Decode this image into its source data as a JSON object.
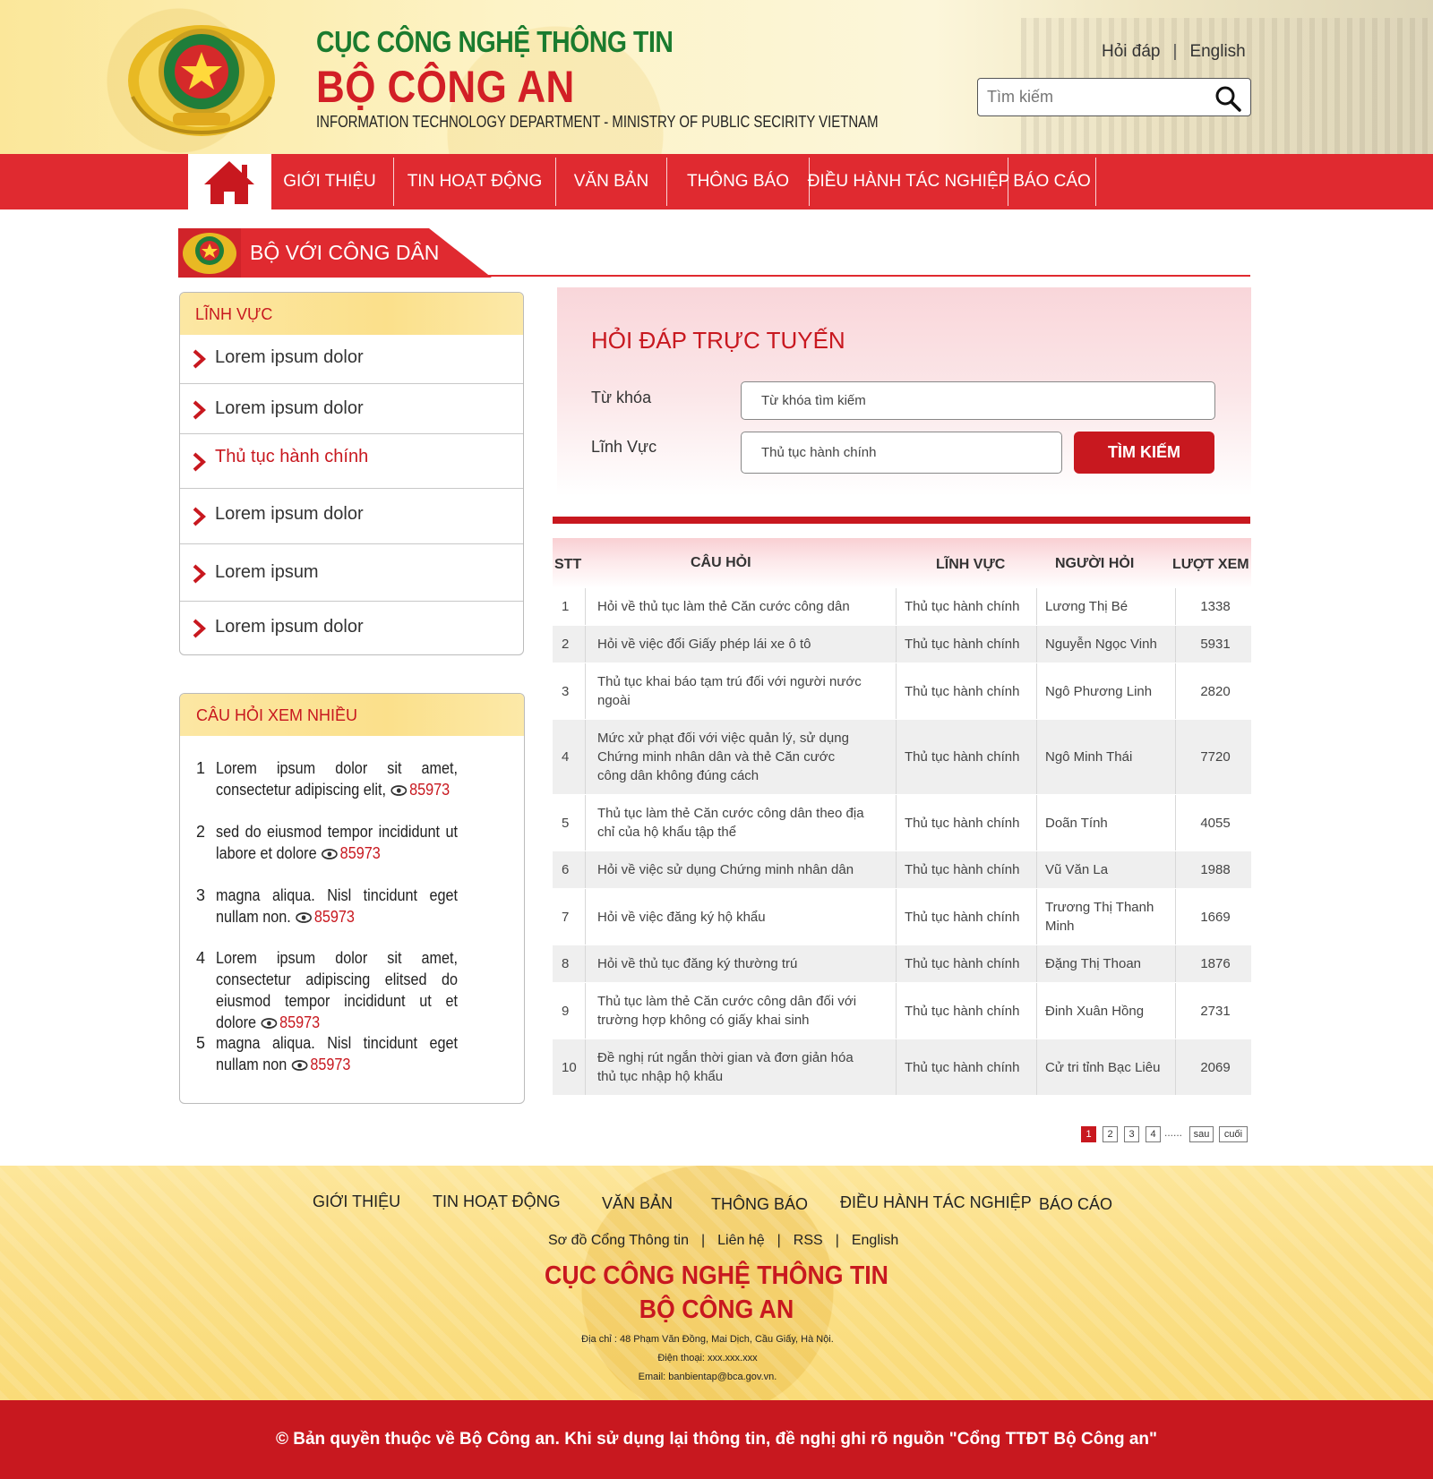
{
  "header": {
    "title_line1": "CỤC CÔNG NGHỆ THÔNG TIN",
    "title_line2": "BỘ CÔNG AN",
    "subtitle": "INFORMATION TECHNOLOGY DEPARTMENT - MINISTRY OF PUBLIC SECIRITY VIETNAM",
    "links": [
      "Hỏi đáp",
      "English"
    ],
    "search_placeholder": "Tìm kiếm"
  },
  "nav": {
    "items": [
      "GIỚI THIỆU",
      "TIN HOẠT ĐỘNG",
      "VĂN BẢN",
      "THÔNG BÁO",
      "ĐIỀU HÀNH TÁC NGHIỆP",
      "BÁO CÁO"
    ]
  },
  "section_title": "BỘ VỚI CÔNG DÂN",
  "sidebar": {
    "categories_title": "LĨNH VỰC",
    "categories": [
      "Lorem ipsum dolor",
      "Lorem ipsum dolor",
      "Thủ tục hành chính",
      "Lorem ipsum dolor",
      "Lorem ipsum",
      "Lorem ipsum dolor"
    ],
    "popular_title": "CÂU HỎI XEM NHIỀU",
    "popular": [
      {
        "num": "1",
        "text": "Lorem ipsum dolor sit amet, consectetur adipiscing elit,",
        "views": "85973"
      },
      {
        "num": "2",
        "text": "sed do eiusmod tempor incididunt ut labore et dolore",
        "views": "85973"
      },
      {
        "num": "3",
        "text": "magna aliqua. Nisl tincidunt eget nullam non.",
        "views": "85973"
      },
      {
        "num": "4",
        "text": "Lorem ipsum dolor sit amet, consectetur adipiscing elitsed do eiusmod tempor incididunt ut et dolore",
        "views": "85973"
      },
      {
        "num": "5",
        "text": "magna aliqua. Nisl tincidunt eget nullam non",
        "views": "85973"
      }
    ]
  },
  "search_panel": {
    "title": "HỎI ĐÁP TRỰC TUYẾN",
    "keyword_label": "Từ khóa",
    "keyword_placeholder": "Từ khóa tìm kiếm",
    "field_label": "Lĩnh Vực",
    "field_value": "Thủ tục hành chính",
    "button": "TÌM KIẾM"
  },
  "table": {
    "headers": [
      "STT",
      "CÂU HỎI",
      "LĨNH VỰC",
      "NGƯỜI HỎI",
      "LƯỢT XEM"
    ],
    "rows": [
      {
        "stt": "1",
        "question": "Hỏi về thủ tục làm thẻ Căn cước công dân",
        "field": "Thủ tục hành chính",
        "asker": "Lương Thị Bé",
        "views": "1338"
      },
      {
        "stt": "2",
        "question": "Hỏi về việc đổi Giấy phép lái xe ô tô",
        "field": "Thủ tục hành chính",
        "asker": "Nguyễn Ngọc Vinh",
        "views": "5931"
      },
      {
        "stt": "3",
        "question": "Thủ tục khai báo tạm trú đối với người nước ngoài",
        "field": "Thủ tục hành chính",
        "asker": "Ngô Phương Linh",
        "views": "2820"
      },
      {
        "stt": "4",
        "question": "Mức xử phạt đối với việc quản lý, sử dụng Chứng minh nhân dân và thẻ Căn cước công dân không đúng cách",
        "field": "Thủ tục hành chính",
        "asker": "Ngô Minh Thái",
        "views": "7720"
      },
      {
        "stt": "5",
        "question": "Thủ tục làm thẻ Căn cước công dân theo địa chỉ của hộ khẩu tập thể",
        "field": "Thủ tục hành chính",
        "asker": "Doãn Tính",
        "views": "4055"
      },
      {
        "stt": "6",
        "question": "Hỏi về việc sử dụng Chứng minh nhân dân",
        "field": "Thủ tục hành chính",
        "asker": "Vũ Văn La",
        "views": "1988"
      },
      {
        "stt": "7",
        "question": "Hỏi về việc đăng ký hộ khẩu",
        "field": "Thủ tục hành chính",
        "asker": "Trương Thị Thanh Minh",
        "views": "1669"
      },
      {
        "stt": "8",
        "question": "Hỏi về thủ tục đăng ký thường trú",
        "field": "Thủ tục hành chính",
        "asker": "Đặng Thị Thoan",
        "views": "1876"
      },
      {
        "stt": "9",
        "question": "Thủ tục làm thẻ Căn cước công dân đối với trường hợp không có giấy khai sinh",
        "field": "Thủ tục hành chính",
        "asker": "Đinh Xuân Hồng",
        "views": "2731"
      },
      {
        "stt": "10",
        "question": "Đề nghị rút ngắn thời gian và đơn giản hóa thủ tục nhập hộ khẩu",
        "field": "Thủ tục hành chính",
        "asker": "Cử tri tỉnh Bạc Liêu",
        "views": "2069"
      }
    ]
  },
  "pagination": {
    "pages": [
      "1",
      "2",
      "3",
      "4"
    ],
    "current": "1",
    "ellipsis": "......",
    "next": "sau",
    "last": "cuối"
  },
  "footer": {
    "nav": [
      "GIỚI THIỆU",
      "TIN HOẠT ĐỘNG",
      "VĂN BẢN",
      "THÔNG BÁO",
      "ĐIỀU HÀNH TÁC NGHIỆP",
      "BÁO CÁO"
    ],
    "links": [
      "Sơ đồ Cổng Thông tin",
      "Liên hệ",
      "RSS",
      "English"
    ],
    "title_line1": "CỤC CÔNG NGHỆ THÔNG TIN",
    "title_line2": "BỘ CÔNG AN",
    "address": "Địa chỉ : 48 Phạm Văn Đồng, Mai Dịch, Cầu Giấy, Hà Nội.",
    "phone": "Điện thoại: xxx.xxx.xxx",
    "email": "Email: banbientap@bca.gov.vn.",
    "copyright": "© Bản quyền thuộc về Bộ Công an. Khi sử dụng lại thông tin, đề nghị ghi rõ nguồn \"Cổng TTĐT Bộ Công an\""
  },
  "colors": {
    "primary_red": "#e02a30",
    "dark_red": "#c8181f",
    "gold": "#fbe08a",
    "green": "#1a7b2e"
  },
  "icons": [
    "emblem-logo",
    "search-icon",
    "home-icon",
    "chevron-right-icon",
    "eye-icon"
  ]
}
